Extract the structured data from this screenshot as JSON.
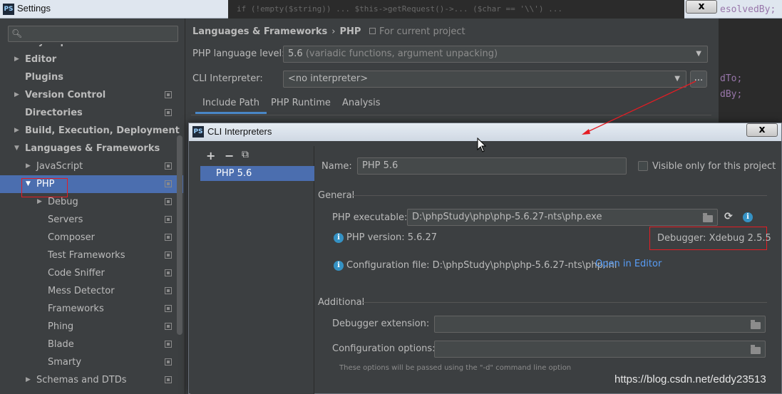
{
  "settings_window": {
    "title": "Settings"
  },
  "background_editor": {
    "top_code": "if (!empty($string)) ... $this->getRequest()->... ($char == '\\\\') ...",
    "right_snippet_1": "esolvedBy;",
    "right_snippet_2": "dTo;",
    "right_snippet_3": "dBy;"
  },
  "sidebar": {
    "search_placeholder": "",
    "items": [
      {
        "label": "Keymap",
        "indent": 0,
        "arrow": "",
        "bold": true,
        "copy": false
      },
      {
        "label": "Editor",
        "indent": 0,
        "arrow": "▶",
        "bold": true,
        "copy": false
      },
      {
        "label": "Plugins",
        "indent": 0,
        "arrow": "",
        "bold": true,
        "copy": false
      },
      {
        "label": "Version Control",
        "indent": 0,
        "arrow": "▶",
        "bold": true,
        "copy": true
      },
      {
        "label": "Directories",
        "indent": 0,
        "arrow": "",
        "bold": true,
        "copy": true
      },
      {
        "label": "Build, Execution, Deployment",
        "indent": 0,
        "arrow": "▶",
        "bold": true,
        "copy": false
      },
      {
        "label": "Languages & Frameworks",
        "indent": 0,
        "arrow": "▼",
        "bold": true,
        "copy": false
      },
      {
        "label": "JavaScript",
        "indent": 1,
        "arrow": "▶",
        "bold": false,
        "copy": true
      },
      {
        "label": "PHP",
        "indent": 1,
        "arrow": "▼",
        "bold": false,
        "copy": true,
        "selected": true
      },
      {
        "label": "Debug",
        "indent": 2,
        "arrow": "▶",
        "bold": false,
        "copy": true
      },
      {
        "label": "Servers",
        "indent": 2,
        "arrow": "",
        "bold": false,
        "copy": true
      },
      {
        "label": "Composer",
        "indent": 2,
        "arrow": "",
        "bold": false,
        "copy": true
      },
      {
        "label": "Test Frameworks",
        "indent": 2,
        "arrow": "",
        "bold": false,
        "copy": true
      },
      {
        "label": "Code Sniffer",
        "indent": 2,
        "arrow": "",
        "bold": false,
        "copy": true
      },
      {
        "label": "Mess Detector",
        "indent": 2,
        "arrow": "",
        "bold": false,
        "copy": true
      },
      {
        "label": "Frameworks",
        "indent": 2,
        "arrow": "",
        "bold": false,
        "copy": true
      },
      {
        "label": "Phing",
        "indent": 2,
        "arrow": "",
        "bold": false,
        "copy": true
      },
      {
        "label": "Blade",
        "indent": 2,
        "arrow": "",
        "bold": false,
        "copy": true
      },
      {
        "label": "Smarty",
        "indent": 2,
        "arrow": "",
        "bold": false,
        "copy": true
      },
      {
        "label": "Schemas and DTDs",
        "indent": 1,
        "arrow": "▶",
        "bold": false,
        "copy": true
      }
    ]
  },
  "breadcrumb": {
    "parent": "Languages & Frameworks",
    "separator": "›",
    "current": "PHP",
    "scope": "For current project"
  },
  "php_settings": {
    "language_level_label": "PHP language level:",
    "language_level_value": "5.6",
    "language_level_desc": "(variadic functions, argument unpacking)",
    "cli_label": "CLI Interpreter:",
    "cli_value": "<no interpreter>",
    "more_button": "...",
    "tabs": [
      "Include Path",
      "PHP Runtime",
      "Analysis"
    ]
  },
  "dialog": {
    "title": "CLI Interpreters",
    "toolbar": {
      "add": "+",
      "remove": "−",
      "copy": "⧉"
    },
    "interpreters": [
      "PHP 5.6"
    ],
    "name_label": "Name:",
    "name_value": "PHP 5.6",
    "visible_only_label": "Visible only for this project",
    "general_section": "General",
    "executable_label": "PHP executable:",
    "executable_value": "D:\\phpStudy\\php\\php-5.6.27-nts\\php.exe",
    "php_version": "PHP version: 5.6.27",
    "debugger": "Debugger: Xdebug 2.5.5",
    "config_file": "Configuration file: D:\\phpStudy\\php\\php-5.6.27-nts\\php.ini",
    "open_in_editor": "Open in Editor",
    "additional_section": "Additional",
    "debugger_ext_label": "Debugger extension:",
    "debugger_ext_value": "",
    "config_options_label": "Configuration options:",
    "config_options_value": "",
    "hint": "These options will be passed using the \"-d\" command line option"
  },
  "window_close_glyph": "x",
  "watermark": "https://blog.csdn.net/eddy23513"
}
